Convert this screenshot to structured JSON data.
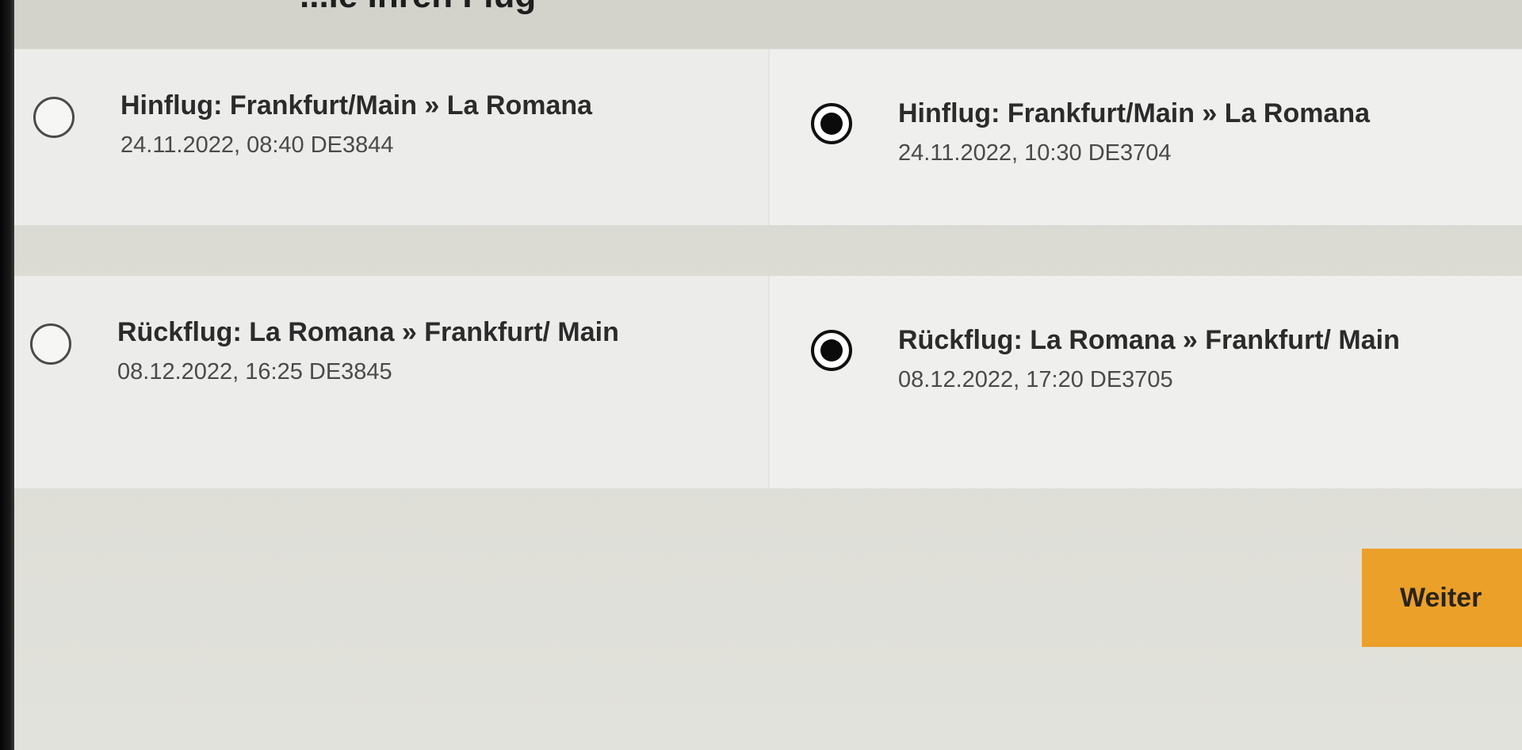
{
  "header": {
    "partial_title": "...ie Ihren Flug"
  },
  "outbound": {
    "options": [
      {
        "title": "Hinflug: Frankfurt/Main » La Romana",
        "detail": "24.11.2022, 08:40 DE3844",
        "selected": false
      },
      {
        "title": "Hinflug: Frankfurt/Main » La Romana",
        "detail": "24.11.2022, 10:30 DE3704",
        "selected": true
      }
    ]
  },
  "return": {
    "options": [
      {
        "title": "Rückflug: La Romana » Frankfurt/ Main",
        "detail": "08.12.2022, 16:25 DE3845",
        "selected": false
      },
      {
        "title": "Rückflug: La Romana » Frankfurt/ Main",
        "detail": "08.12.2022, 17:20 DE3705",
        "selected": true
      }
    ]
  },
  "actions": {
    "next_label": "Weiter"
  },
  "colors": {
    "accent": "#eba02a",
    "background": "#dcdcd4",
    "card": "#ececea"
  }
}
